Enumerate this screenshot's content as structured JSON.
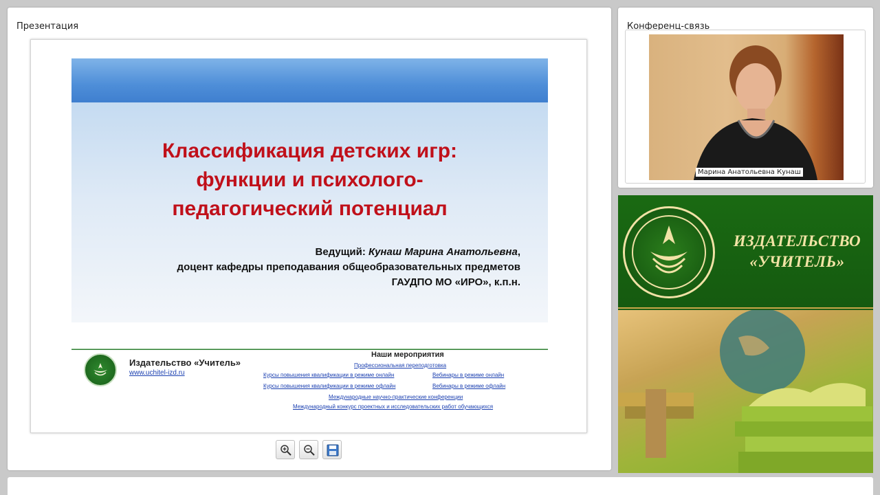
{
  "presentation": {
    "panel_title": "Презентация",
    "slide": {
      "title_lines": [
        "Классификация детских игр:",
        "функции и психолого-",
        "педагогический потенциал"
      ],
      "presenter_label": "Ведущий:",
      "presenter_name": "Кунаш Марина Анатольевна",
      "presenter_comma": ",",
      "presenter_position": "доцент кафедры преподавания общеобразовательных предметов",
      "presenter_org": "ГАУДПО МО «ИРО», к.п.н.",
      "footer": {
        "publisher": "Издательство «Учитель»",
        "url": "www.uchitel-izd.ru",
        "events_title": "Наши мероприятия",
        "events": [
          "Профессиональная переподготовка",
          "Курсы повышения квалификации в режиме онлайн",
          "Вебинары в режиме онлайн",
          "Курсы повышения квалификации в режиме офлайн",
          "Вебинары в режиме офлайн",
          "Международные научно-практические конференции",
          "Международный конкурс проектных и исследовательских работ обучающихся"
        ]
      }
    },
    "controls": {
      "zoom_in_icon": "zoom-in-icon",
      "zoom_out_icon": "zoom-out-icon",
      "save_icon": "save-icon"
    }
  },
  "conference": {
    "panel_title": "Конференц-связь",
    "participant_name": "Марина Анатольевна Кунаш"
  },
  "publisher_banner": {
    "name_lines": [
      "ИЗДАТЕЛЬСТВО",
      "«УЧИТЕЛЬ»"
    ]
  },
  "colors": {
    "slide_title": "#c0101a",
    "banner_green": "#1a6a12",
    "banner_text": "#f3e4a6",
    "link_blue": "#1a3fb0"
  }
}
